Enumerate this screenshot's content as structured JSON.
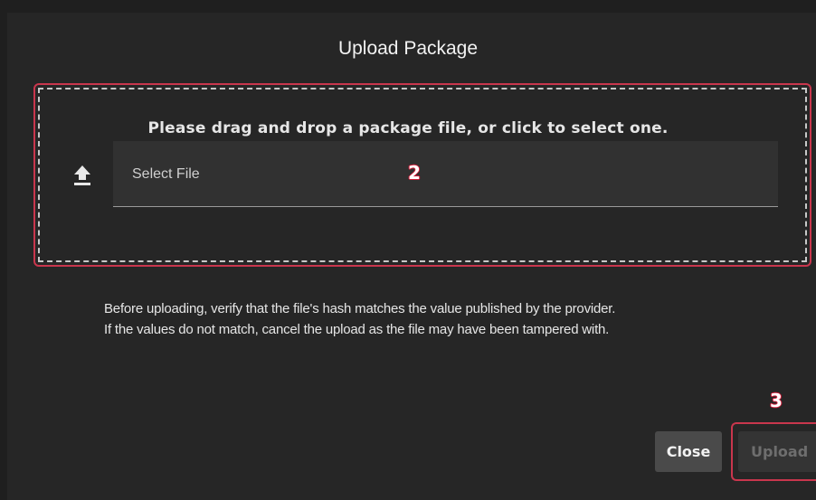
{
  "dialog": {
    "title": "Upload Package",
    "dropzone": {
      "instructions": "Please drag and drop a package file, or click to select one.",
      "icon": "upload-icon",
      "file_field_label": "Select File"
    },
    "notice": {
      "line1": "Before uploading, verify that the file's hash matches the value published by the provider.",
      "line2": "If the values do not match, cancel the upload as the file may have been tampered with."
    },
    "buttons": {
      "close_label": "Close",
      "upload_label": "Upload"
    }
  },
  "annotations": {
    "marker_dropzone": "2",
    "marker_upload": "3"
  },
  "colors": {
    "background": "#262626",
    "annotation_red": "#c9364d",
    "close_button": "#4a4a4a",
    "upload_button_disabled": "#343434"
  }
}
